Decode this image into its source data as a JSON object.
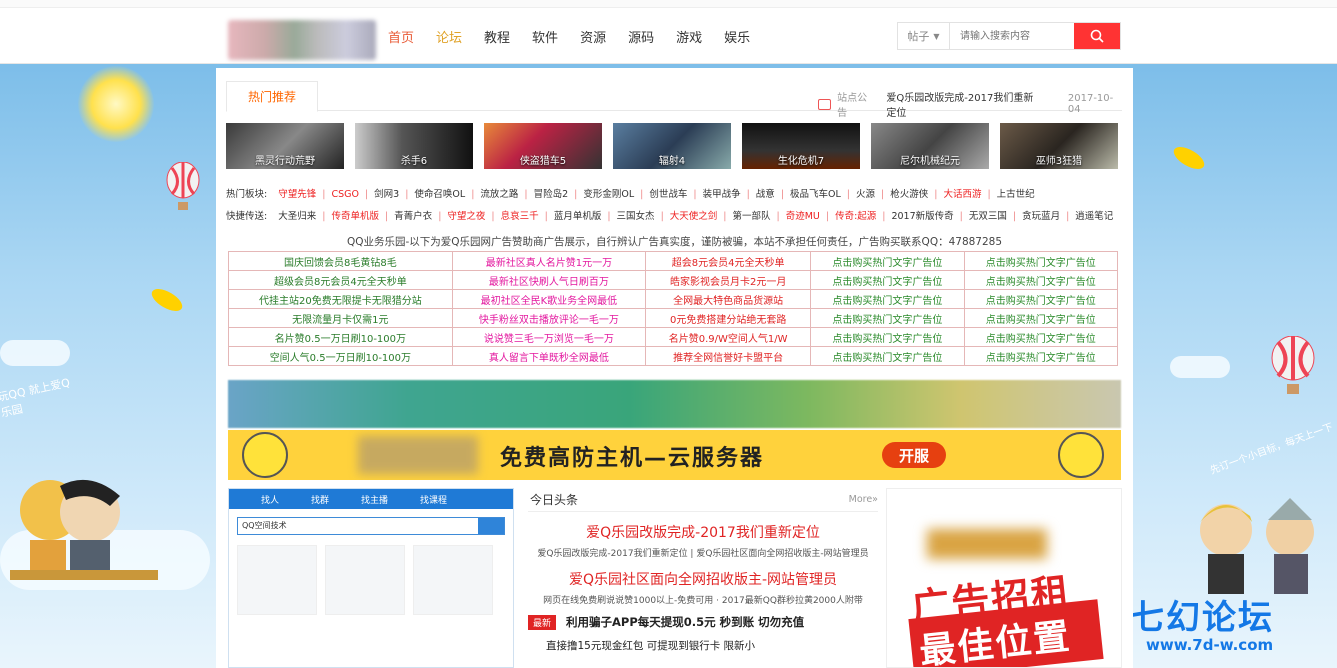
{
  "header": {
    "nav": [
      "首页",
      "论坛",
      "教程",
      "软件",
      "资源",
      "源码",
      "游戏",
      "娱乐"
    ],
    "search": {
      "select_label": "帖子",
      "placeholder": "请输入搜索内容"
    }
  },
  "tabs": {
    "hot": "热门推荐"
  },
  "notice": {
    "label": "站点公告",
    "text": "爱Q乐园改版完成-2017我们重新定位",
    "date": "2017-10-04"
  },
  "thumbs": [
    "黑灵行动荒野",
    "杀手6",
    "侠盗猎车5",
    "辐射4",
    "生化危机7",
    "尼尔机械纪元",
    "巫师3狂猎"
  ],
  "hot_sections": {
    "label": "热门板块:",
    "items": [
      {
        "t": "守望先锋",
        "red": true
      },
      {
        "t": "CSGO",
        "red": true
      },
      {
        "t": "剑网3"
      },
      {
        "t": "使命召唤OL"
      },
      {
        "t": "流放之路"
      },
      {
        "t": "冒险岛2"
      },
      {
        "t": "变形金刚OL"
      },
      {
        "t": "创世战车"
      },
      {
        "t": "装甲战争"
      },
      {
        "t": "战意"
      },
      {
        "t": "极品飞车OL"
      },
      {
        "t": "火源"
      },
      {
        "t": "枪火游侠"
      },
      {
        "t": "大话西游",
        "red": true
      },
      {
        "t": "上古世纪"
      }
    ]
  },
  "quick_links": {
    "label": "快捷传送:",
    "items": [
      {
        "t": "大圣归来"
      },
      {
        "t": "传奇单机版",
        "red": true
      },
      {
        "t": "青菁户衣"
      },
      {
        "t": "守望之夜",
        "red": true
      },
      {
        "t": "息哀三千",
        "red": true
      },
      {
        "t": "蓝月单机版"
      },
      {
        "t": "三国女杰"
      },
      {
        "t": "大天使之剑",
        "red": true
      },
      {
        "t": "第一部队"
      },
      {
        "t": "奇迹MU",
        "red": true
      },
      {
        "t": "传奇:起源",
        "red": true
      },
      {
        "t": "2017新版传奇"
      },
      {
        "t": "无双三国"
      },
      {
        "t": "贪玩蓝月"
      },
      {
        "t": "逍遥笔记"
      }
    ]
  },
  "ad_line": "QQ业务乐园-以下为爱Q乐园网广告赞助商广告展示，自行辨认广告真实度，谨防被骗，本站不承担任何责任，广告购买联系QQ：47887285",
  "ads_table": [
    [
      "国庆回馈会员8毛黄钻8毛",
      "最新社区真人名片赞1元一万",
      "超会8元会员4元全天秒单",
      "点击购买热门文字广告位",
      "点击购买热门文字广告位"
    ],
    [
      "超级会员8元会员4元全天秒单",
      "最新社区快刷人气日刷百万",
      "皓家影视会员月卡2元一月",
      "点击购买热门文字广告位",
      "点击购买热门文字广告位"
    ],
    [
      "代挂主站20免费无限提卡无限猎分站",
      "最初社区全民K歌业务全网最低",
      "全网最大特色商品货源站",
      "点击购买热门文字广告位",
      "点击购买热门文字广告位"
    ],
    [
      "无限流量月卡仅需1元",
      "快手粉丝双击播放评论一毛一万",
      "0元免费搭建分站绝无套路",
      "点击购买热门文字广告位",
      "点击购买热门文字广告位"
    ],
    [
      "名片赞0.5一万日刷10-100万",
      "说说赞三毛一万浏览一毛一万",
      "名片赞0.9/W空间人气1/W",
      "点击购买热门文字广告位",
      "点击购买热门文字广告位"
    ],
    [
      "空间人气0.5一万日刷10-100万",
      "真人留言下单既秒全网最低",
      "推荐全网信誉好卡盟平台",
      "点击购买热门文字广告位",
      "点击购买热门文字广告位"
    ]
  ],
  "banner2": {
    "text": "免费高防主机—云服务器",
    "button": "开服"
  },
  "qq": {
    "tabs": [
      "找人",
      "找群",
      "找主播",
      "找课程"
    ],
    "query": "QQ空间技术"
  },
  "news": {
    "title": "今日头条",
    "more": "More»",
    "headline1": "爱Q乐园改版完成-2017我们重新定位",
    "sub1": "爱Q乐园改版完成-2017我们重新定位 | 爱Q乐园社区面向全网招收版主-网站管理员",
    "headline2": "爱Q乐园社区面向全网招收版主-网站管理员",
    "sub2": "网页在线免费刷说说赞1000以上-免费可用 · 2017最新QQ群秒拉黄2000人附带",
    "tag": "最新",
    "item1": "利用骗子APP每天提现0.5元 秒到账 切勿充值",
    "item2": "直接撸15元现金红包 可提现到银行卡 限新小"
  },
  "right_ad": {
    "line1": "广告招租",
    "line2": "最佳位置"
  },
  "deco": {
    "sign": "玩QQ 就上爱Q乐园",
    "brand": "七幻论坛",
    "brand_url": "www.7d-w.com",
    "slogan": "先订一个小目标，每天上一下"
  },
  "colors": {
    "accent": "#e95c38",
    "red": "#e02424",
    "blue": "#1478e6"
  }
}
